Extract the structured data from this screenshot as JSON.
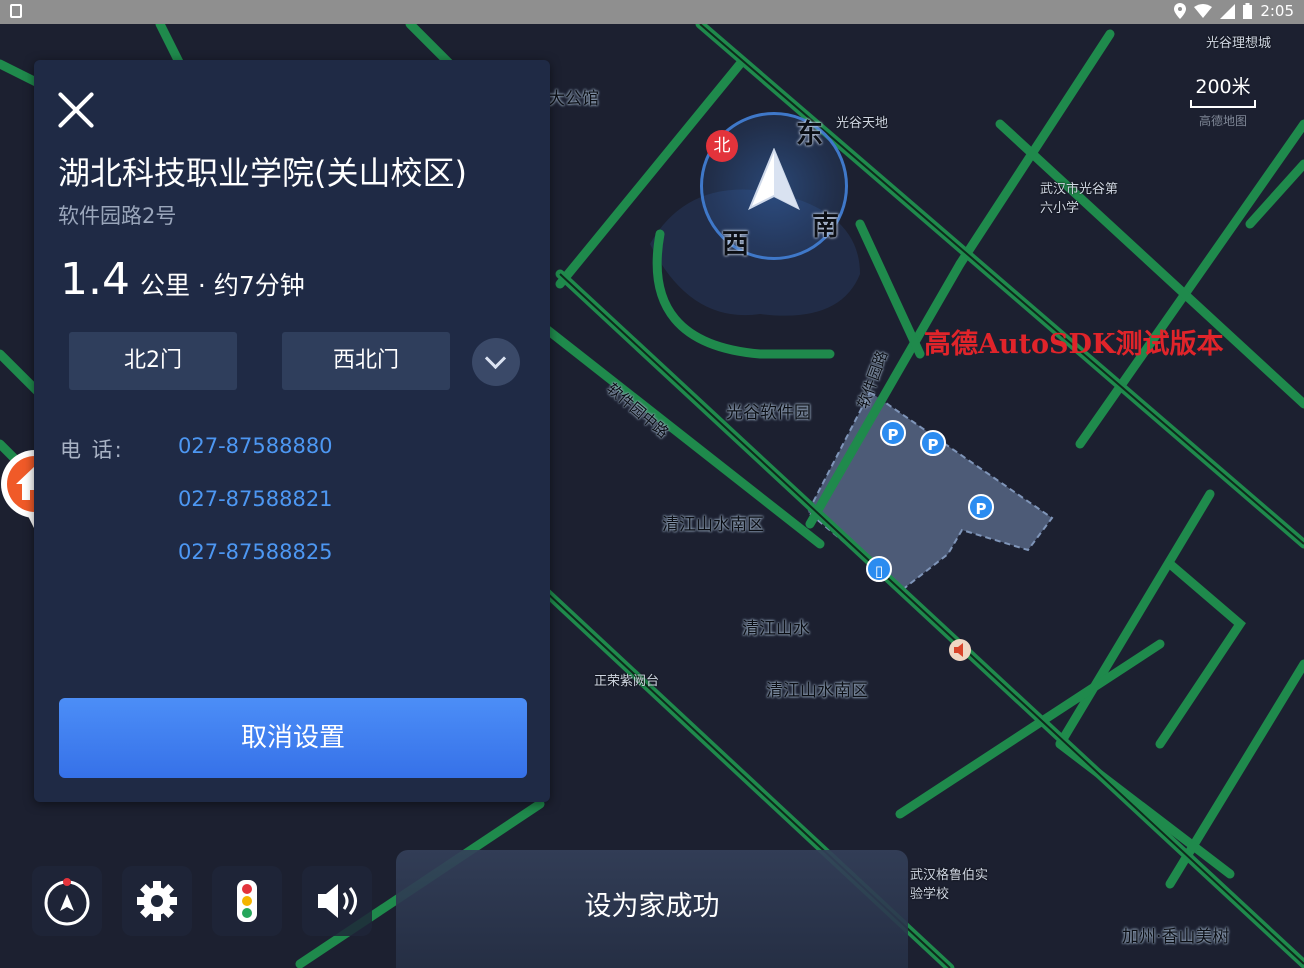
{
  "status_bar": {
    "time": "2:05",
    "icons": [
      "location-icon",
      "wifi-icon",
      "signal-icon",
      "battery-icon"
    ]
  },
  "map": {
    "scale_label": "200米",
    "scale_sub": "高德地图",
    "watermark": "高德AutoSDK测试版本",
    "compass": {
      "north": "北",
      "east": "东",
      "south": "南",
      "west": "西"
    },
    "labels": [
      "光谷软件园",
      "清江山水南区",
      "清江山水",
      "清江山水南区",
      "软件园中路",
      "软件园路",
      "武汉市光谷第六小学",
      "光谷理想城",
      "光谷天地",
      "正荣紫阙台",
      "武汉格鲁伯实验学校",
      "加州·香山美树",
      "大公馆"
    ],
    "colors": {
      "road": "#1f8a4c",
      "block": "#1f2433",
      "highlight": "#5a6a8a"
    }
  },
  "panel": {
    "name": "湖北科技职业学院(关山校区)",
    "address": "软件园路2号",
    "distance_value": "1.4",
    "distance_unit": "公里 · 约7分钟",
    "gates": [
      "北2门",
      "西北门"
    ],
    "phone_label": "电    话:",
    "phones": [
      "027-87588880",
      "027-87588821",
      "027-87588825"
    ],
    "cancel_label": "取消设置"
  },
  "toast": "设为家成功",
  "controls": [
    "compass-icon",
    "settings-icon",
    "traffic-light-icon",
    "volume-icon"
  ]
}
